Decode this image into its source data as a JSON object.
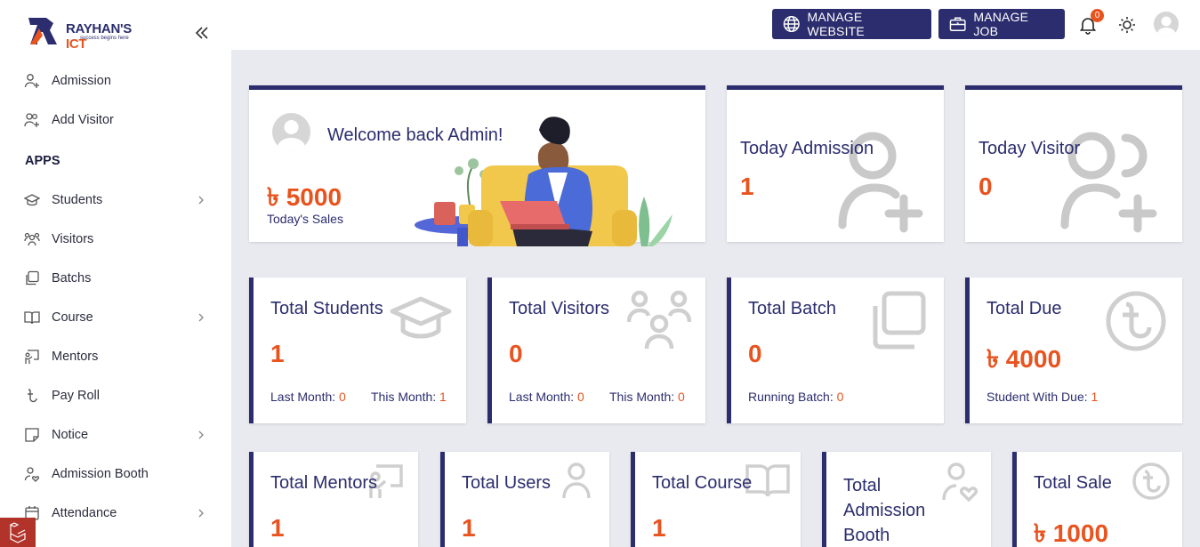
{
  "brand": {
    "name_main": "RAYHAN'S",
    "name_accent": "ICT",
    "tagline": "success begins here"
  },
  "sidebar": {
    "items_top": [
      {
        "label": "Admission"
      },
      {
        "label": "Add Visitor"
      }
    ],
    "section_label": "APPS",
    "apps": [
      {
        "label": "Students"
      },
      {
        "label": "Visitors"
      },
      {
        "label": "Batchs"
      },
      {
        "label": "Course"
      },
      {
        "label": "Mentors"
      },
      {
        "label": "Pay Roll"
      },
      {
        "label": "Notice"
      },
      {
        "label": "Admission Booth"
      },
      {
        "label": "Attendance"
      }
    ]
  },
  "topbar": {
    "manage_website": "MANAGE WEBSITE",
    "manage_job": "MANAGE JOB",
    "notification_count": "0"
  },
  "welcome": {
    "greeting": "Welcome back Admin!",
    "sales_value": "৳ 5000",
    "sales_label": "Today's Sales"
  },
  "today_admission": {
    "title": "Today Admission",
    "value": "1"
  },
  "today_visitor": {
    "title": "Today Visitor",
    "value": "0"
  },
  "total_students": {
    "title": "Total Students",
    "value": "1",
    "last_label": "Last Month:",
    "last_value": "0",
    "this_label": "This Month:",
    "this_value": "1"
  },
  "total_visitors": {
    "title": "Total Visitors",
    "value": "0",
    "last_label": "Last Month:",
    "last_value": "0",
    "this_label": "This Month:",
    "this_value": "0"
  },
  "total_batch": {
    "title": "Total Batch",
    "value": "0",
    "running_label": "Running Batch:",
    "running_value": "0"
  },
  "total_due": {
    "title": "Total Due",
    "value": "৳ 4000",
    "due_label": "Student With Due:",
    "due_value": "1"
  },
  "row3": [
    {
      "title": "Total Mentors",
      "value": "1"
    },
    {
      "title": "Total Users",
      "value": "1"
    },
    {
      "title": "Total Course",
      "value": "1"
    },
    {
      "title_line1": "Total",
      "title_line2": "Admission",
      "title_line3": "Booth"
    },
    {
      "title": "Total Sale",
      "value": "৳ 1000"
    }
  ],
  "colors": {
    "primary": "#2b2d6e",
    "accent": "#e8531e",
    "background": "#e9eaef"
  }
}
